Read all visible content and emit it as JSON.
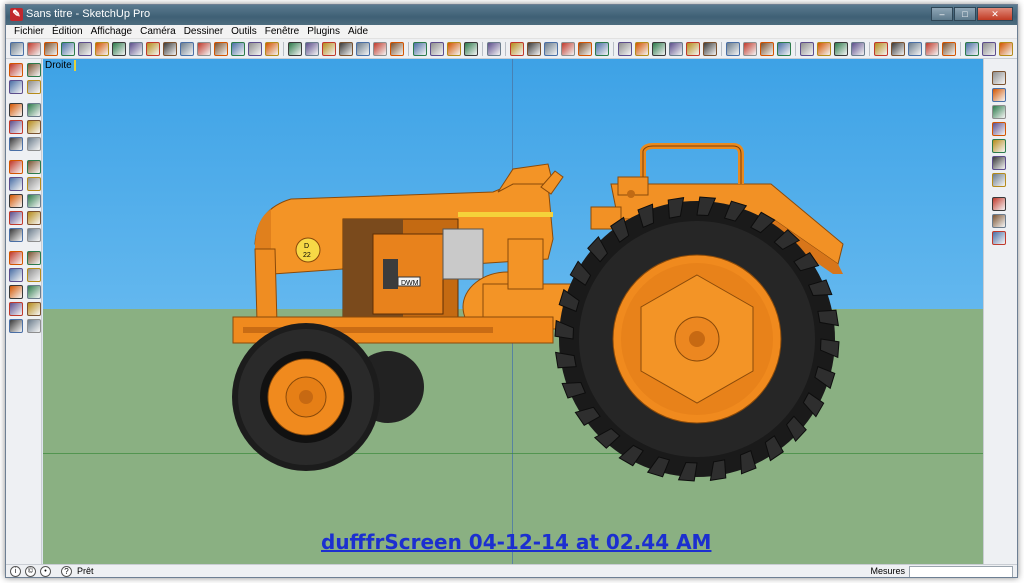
{
  "window": {
    "title": "Sans titre - SketchUp Pro",
    "controls": [
      "–",
      "□",
      "✕"
    ]
  },
  "menu": [
    "Fichier",
    "Édition",
    "Affichage",
    "Caméra",
    "Dessiner",
    "Outils",
    "Fenêtre",
    "Plugins",
    "Aide"
  ],
  "viewport": {
    "view_label": "Droite",
    "watermark": "dufffrScreen 04-12-14 at 02.44 AM",
    "model_badge_letter": "D",
    "model_badge_number": "22",
    "model_plate": "DWM"
  },
  "status": {
    "text": "Prêt",
    "help_icon": "?",
    "measure_label": "Mesures",
    "measure_value": ""
  },
  "colors": {
    "sky_top": "#3da2e6",
    "ground": "#8ab082",
    "tractor_orange": "#f08a1e",
    "tire": "#1c1c1c",
    "watermark": "#1c2fd0"
  },
  "toolbar_icons": [
    "select-icon",
    "eraser-icon",
    "line-icon",
    "rectangle-icon",
    "circle-icon",
    "arc-icon",
    "make-component-icon",
    "eraser2-icon",
    "tape-icon",
    "paint-bucket-icon",
    "push-pull-icon",
    "move-icon",
    "rotate-icon",
    "follow-me-icon",
    "scale-icon",
    "offset-icon",
    "orbit-icon",
    "pan-icon",
    "zoom-icon",
    "zoom-window-icon",
    "zoom-extents-icon",
    "previous-view-icon",
    "next-view-icon",
    "position-camera-icon",
    "walk-icon",
    "look-around-icon",
    "section-plane-icon",
    "display-sections-icon",
    "iso-view-icon",
    "top-view-icon",
    "front-view-icon",
    "right-view-icon",
    "back-view-icon",
    "left-view-icon",
    "xray-icon",
    "wireframe-icon",
    "hidden-line-icon",
    "shaded-icon",
    "shaded-textures-icon",
    "monochrome-icon",
    "parallel-projection-icon",
    "perspective-icon",
    "two-point-icon",
    "match-photo-icon",
    "shadows-icon",
    "fog-icon",
    "edge-style-icon",
    "profiles-icon",
    "axes-icon",
    "guides-icon",
    "dimensions-icon",
    "text-icon",
    "3d-text-icon",
    "add-location-icon",
    "toggle-terrain-icon",
    "photo-textures-icon",
    "warehouse-icon",
    "share-model-icon",
    "extension-icon",
    "layout-icon",
    "send-icon"
  ],
  "left_palette_icons": [
    "select-icon",
    "make-component-icon",
    "rectangle-icon",
    "line-icon",
    "circle-icon",
    "arc-icon",
    "polygon-icon",
    "freehand-icon",
    "push-pull-icon",
    "follow-me-icon",
    "move-icon",
    "rotate-icon",
    "scale-icon",
    "offset-icon",
    "tape-icon",
    "dimension-icon",
    "protractor-icon",
    "text-icon",
    "axes-icon",
    "3d-text-icon",
    "orbit-icon",
    "pan-icon",
    "zoom-icon",
    "zoom-window-icon",
    "zoom-extents-icon",
    "previous-icon",
    "position-camera-icon",
    "look-around-icon",
    "walk-icon",
    "section-plane-icon"
  ],
  "right_palette_icons": [
    "sandbox-contours-icon",
    "sandbox-scratch-icon",
    "smoove-icon",
    "stamp-icon",
    "drape-icon",
    "add-detail-icon",
    "flip-edge-icon",
    "warehouse-icon",
    "share-icon",
    "extension-icon"
  ]
}
